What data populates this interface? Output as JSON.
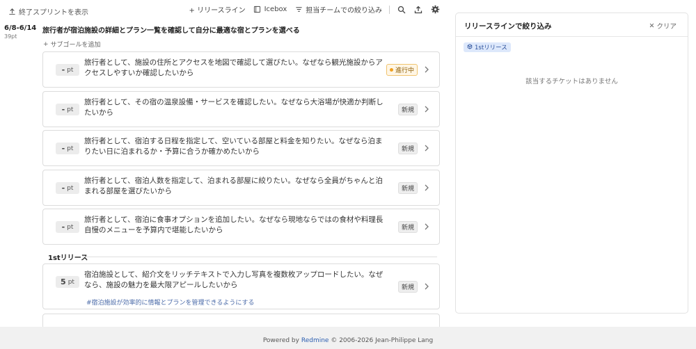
{
  "toolbar": {
    "show_closed": "終了スプリントを表示",
    "release_line": "+ リリースライン",
    "icebox": "Icebox",
    "team_filter": "担当チームでの絞り込み"
  },
  "sprint": {
    "date": "6/8-6/14",
    "points": "39pt",
    "goal": "旅行者が宿泊施設の詳細とプラン一覧を確認して自分に最適な宿とプランを選べる",
    "add_subgoal": "サブゴールを追加"
  },
  "cards": [
    {
      "points": "-",
      "unit": "pt",
      "title": "旅行者として、施設の住所とアクセスを地図で確認して選びたい。なぜなら観光施設からアクセスしやすいか確認したいから",
      "status": "進行中"
    },
    {
      "points": "-",
      "unit": "pt",
      "title": "旅行者として、その宿の温泉設備・サービスを確認したい。なぜなら大浴場が快適か判断したいから",
      "status": "新規"
    },
    {
      "points": "-",
      "unit": "pt",
      "title": "旅行者として、宿泊する日程を指定して、空いている部屋と料金を知りたい。なぜなら泊まりたい日に泊まれるか・予算に合うか確かめたいから",
      "status": "新規"
    },
    {
      "points": "-",
      "unit": "pt",
      "title": "旅行者として、宿泊人数を指定して、泊まれる部屋に絞りたい。なぜなら全員がちゃんと泊まれる部屋を選びたいから",
      "status": "新規"
    },
    {
      "points": "-",
      "unit": "pt",
      "title": "旅行者として、宿泊に食事オプションを追加したい。なぜなら現地ならではの食材や料理長自慢のメニューを予算内で堪能したいから",
      "status": "新規"
    }
  ],
  "release": {
    "label": "1stリリース",
    "card": {
      "points": "5",
      "unit": "pt",
      "title": "宿泊施設として、紹介文をリッチテキストで入力し写真を複数枚アップロードしたい。なぜなら、施設の魅力を最大限アピールしたいから",
      "status": "新規",
      "tag": "#宿泊施設が効率的に情報とプランを管理できるようにする"
    }
  },
  "filter": {
    "title": "リリースラインで絞り込み",
    "clear": "クリア",
    "chip": "1stリリース",
    "empty": "該当するチケットはありません"
  },
  "footer": {
    "powered": "Powered by",
    "brand": "Redmine",
    "copy": "© 2006-2026 Jean-Philippe Lang"
  },
  "colors": {
    "accent": "#2a5db0",
    "chip_bg": "#dde8fb",
    "in_progress": "#f0a020"
  }
}
